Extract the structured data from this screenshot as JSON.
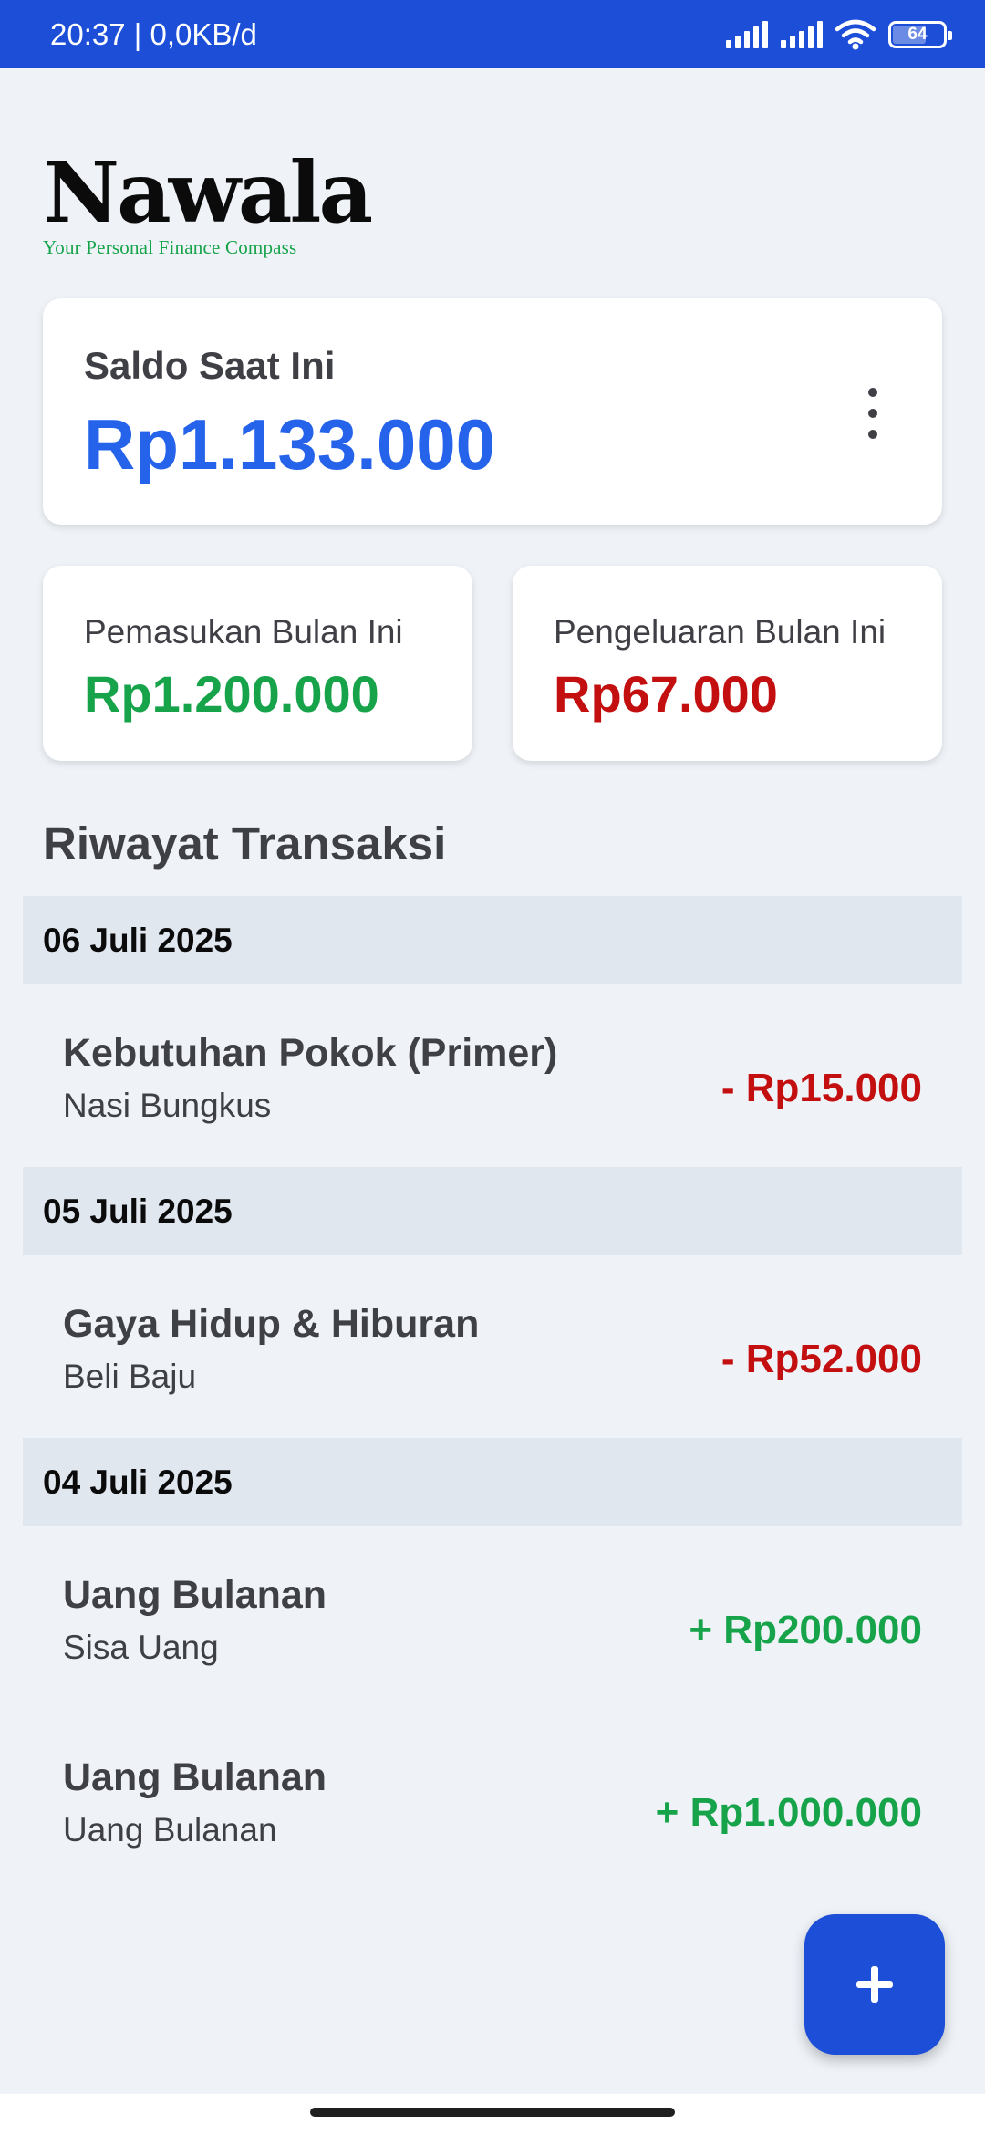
{
  "status_bar": {
    "time_network": "20:37 | 0,0KB/d",
    "battery": "64",
    "icons": [
      "signal-icon",
      "signal-icon",
      "wifi-icon",
      "battery-icon"
    ]
  },
  "app": {
    "title": "Nawala",
    "tagline": "Your Personal Finance Compass"
  },
  "balance": {
    "label": "Saldo Saat Ini",
    "value": "Rp1.133.000"
  },
  "stats": {
    "income_label": "Pemasukan Bulan Ini",
    "income_value": "Rp1.200.000",
    "expense_label": "Pengeluaran Bulan Ini",
    "expense_value": "Rp67.000"
  },
  "history": {
    "title": "Riwayat Transaksi",
    "groups": [
      {
        "date": "06 Juli 2025",
        "items": [
          {
            "category": "Kebutuhan Pokok (Primer)",
            "description": "Nasi Bungkus",
            "amount": "- Rp15.000"
          }
        ]
      },
      {
        "date": "05 Juli 2025",
        "items": [
          {
            "category": "Gaya Hidup & Hiburan",
            "description": "Beli Baju",
            "amount": "- Rp52.000"
          }
        ]
      },
      {
        "date": "04 Juli 2025",
        "items": [
          {
            "category": "Uang Bulanan",
            "description": "Sisa Uang",
            "amount": "+ Rp200.000"
          },
          {
            "category": "Uang Bulanan",
            "description": "Uang Bulanan",
            "amount": "+ Rp1.000.000"
          }
        ]
      }
    ]
  },
  "colors": {
    "primary": "#1c4ed8",
    "balance": "#2563eb",
    "income": "#16a34a",
    "expense": "#c30f0f",
    "background": "#eff3f8"
  },
  "fab": {
    "icon": "plus-icon"
  }
}
